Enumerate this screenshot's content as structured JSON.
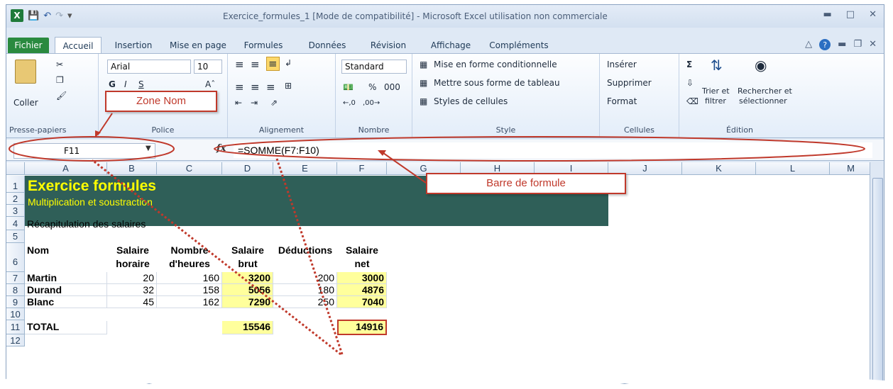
{
  "window": {
    "title": "Exercice_formules_1  [Mode de compatibilité]  -  Microsoft Excel utilisation non commerciale"
  },
  "tabs": [
    "Fichier",
    "Accueil",
    "Insertion",
    "Mise en page",
    "Formules",
    "Données",
    "Révision",
    "Affichage",
    "Compléments"
  ],
  "ribbon": {
    "clipboard": {
      "paste": "Coller",
      "label": "Presse-papiers"
    },
    "font": {
      "name": "Arial",
      "size": "10",
      "label": "Police"
    },
    "alignment": {
      "label": "Alignement"
    },
    "number": {
      "format": "Standard",
      "percent": "%",
      "thousands": "000",
      "label": "Nombre"
    },
    "style": {
      "conditional": "Mise en forme conditionnelle",
      "table": "Mettre sous forme de tableau",
      "cellstyles": "Styles de cellules",
      "label": "Style"
    },
    "cells": {
      "insert": "Insérer",
      "delete": "Supprimer",
      "format": "Format",
      "label": "Cellules"
    },
    "editing": {
      "sort1": "Trier et",
      "sort2": "filtrer",
      "find1": "Rechercher et",
      "find2": "sélectionner",
      "label": "Édition"
    }
  },
  "formula_bar": {
    "name_box": "F11",
    "fx": "fx",
    "formula": "=SOMME(F7:F10)"
  },
  "columns": [
    "A",
    "B",
    "C",
    "D",
    "E",
    "F",
    "G",
    "H",
    "I",
    "J",
    "K",
    "L",
    "M"
  ],
  "rows": [
    "1",
    "2",
    "3",
    "4",
    "5",
    "6",
    "7",
    "8",
    "9",
    "10",
    "11",
    "12"
  ],
  "sheet": {
    "title": "Exercice formules",
    "subtitle": "Multiplication et soustraction",
    "recap": "Récapitulation des salaires",
    "headers": {
      "nom": "Nom",
      "sh1": "Salaire",
      "sh2": "horaire",
      "nh1": "Nombre",
      "nh2": "d'heures",
      "sb1": "Salaire",
      "sb2": "brut",
      "ded": "Déductions",
      "sn1": "Salaire",
      "sn2": "net"
    },
    "data": [
      {
        "nom": "Martin",
        "horaire": "20",
        "heures": "160",
        "brut": "3200",
        "ded": "200",
        "net": "3000"
      },
      {
        "nom": "Durand",
        "horaire": "32",
        "heures": "158",
        "brut": "5056",
        "ded": "180",
        "net": "4876"
      },
      {
        "nom": "Blanc",
        "horaire": "45",
        "heures": "162",
        "brut": "7290",
        "ded": "250",
        "net": "7040"
      }
    ],
    "total": {
      "label": "TOTAL",
      "brut": "15546",
      "net": "14916"
    }
  },
  "callouts": {
    "zone_nom": "Zone Nom",
    "barre": "Barre de formule"
  },
  "colors": {
    "band": "#2f5f58",
    "accent_yellow": "#ffff00",
    "highlight": "#ffff9c",
    "callout": "#c0392b"
  }
}
